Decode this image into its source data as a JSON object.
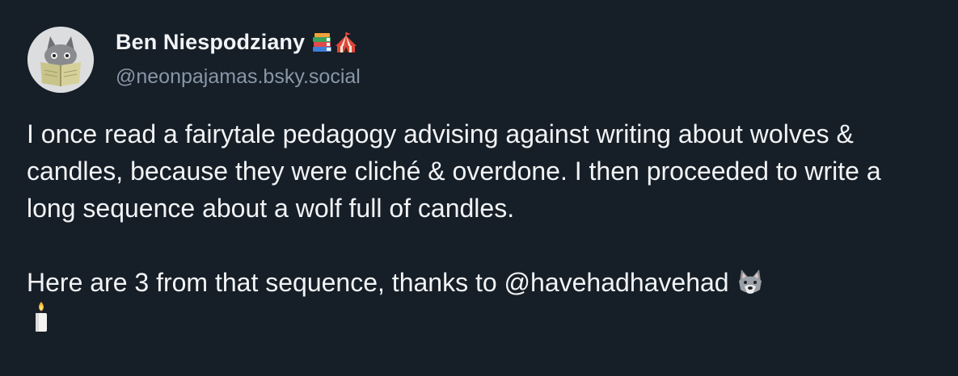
{
  "author": {
    "display_name": "Ben Niespodziany",
    "name_emojis": [
      "books-icon",
      "circus-tent-icon"
    ],
    "handle": "@neonpajamas.bsky.social",
    "avatar": "wolf-reading-book-avatar"
  },
  "post": {
    "paragraph_1": "I once read a fairytale pedagogy advising against writing about wolves & candles, because they were cliché & overdone. I then proceeded to write a long sequence about a wolf full of candles.",
    "paragraph_2_prefix": "Here are 3 from that sequence, thanks to ",
    "mention": "@havehadhavehad",
    "paragraph_2_emojis": [
      "wolf-icon",
      "candle-icon"
    ]
  },
  "colors": {
    "background": "#161e27",
    "text": "#f1f3f5",
    "handle": "#8797a8"
  }
}
